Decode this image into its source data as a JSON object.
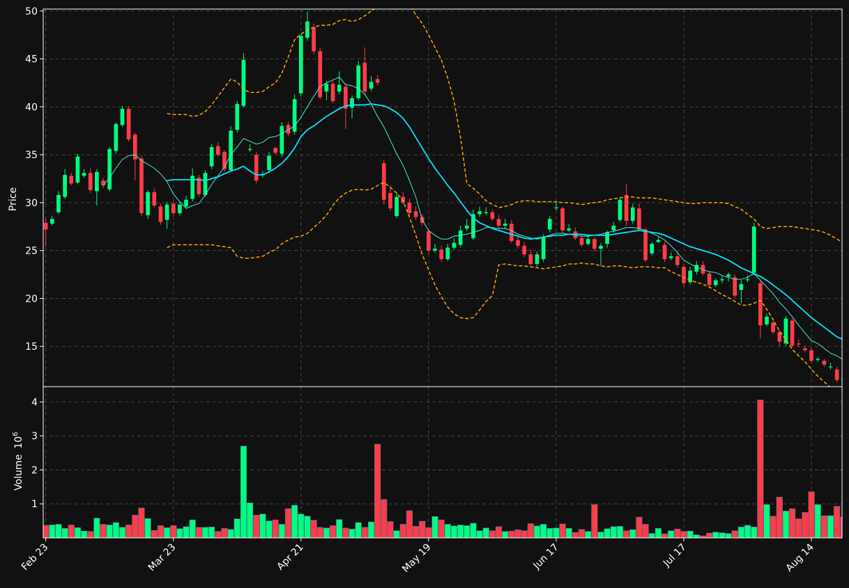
{
  "chart_data": {
    "type": "candlestick",
    "colors": {
      "background": "#111111",
      "up": "#00ff7f",
      "down": "#ff3d47",
      "sma_fast": "#4de8d8",
      "sma_slow": "#00e5ff",
      "bands": "#ffa500",
      "grid": "#444444",
      "frame": "#ffffff"
    },
    "price_axis": {
      "label": "Price",
      "ylim": [
        10.8,
        50.2
      ],
      "ticks": [
        15,
        20,
        25,
        30,
        35,
        40,
        45,
        50
      ]
    },
    "volume_axis": {
      "label": "Volume",
      "exponent_label": "10",
      "exponent": "6",
      "ylim": [
        0,
        4.45
      ],
      "ticks": [
        1,
        2,
        3,
        4
      ]
    },
    "x_axis": {
      "ticks": [
        {
          "index": 0,
          "label": "Feb 23"
        },
        {
          "index": 20,
          "label": "Mar 23"
        },
        {
          "index": 40,
          "label": "Apr 21"
        },
        {
          "index": 60,
          "label": "May 19"
        },
        {
          "index": 80,
          "label": "Jun 17"
        },
        {
          "index": 100,
          "label": "Jul 17"
        },
        {
          "index": 120,
          "label": "Aug 14"
        }
      ]
    },
    "close": [
      27.2,
      28.3,
      30.8,
      32.9,
      32.0,
      34.8,
      33.1,
      31.3,
      33.2,
      31.8,
      35.6,
      38.2,
      39.8,
      36.6,
      34.5,
      28.9,
      31.1,
      29.7,
      28.0,
      29.8,
      28.9,
      29.8,
      30.3,
      32.8,
      30.9,
      33.1,
      35.8,
      35.0,
      33.5,
      37.5,
      40.3,
      44.9,
      35.6,
      32.3,
      33.0,
      34.9,
      35.2,
      38.0,
      37.2,
      40.8,
      47.4,
      48.9,
      45.8,
      41.0,
      42.4,
      40.6,
      42.3,
      39.8,
      40.9,
      44.3,
      41.6,
      42.6,
      42.5,
      30.3,
      29.4,
      30.6,
      30.0,
      28.9,
      28.5,
      27.9,
      25.0,
      25.2,
      24.1,
      25.3,
      25.8,
      27.1,
      27.6,
      28.8,
      29.1,
      29.0,
      28.3,
      27.6,
      27.8,
      26.0,
      25.5,
      24.6,
      23.6,
      24.6,
      26.4,
      28.3,
      29.5,
      27.1,
      27.3,
      26.3,
      25.6,
      26.2,
      25.2,
      25.5,
      26.9,
      27.6,
      30.3,
      28.1,
      29.5,
      27.2,
      24.0,
      25.7,
      26.1,
      24.1,
      24.4,
      23.5,
      21.6,
      22.9,
      23.5,
      22.6,
      21.4,
      21.9,
      22.0,
      22.5,
      20.3,
      21.5,
      22.0,
      27.5,
      17.2,
      18.1,
      16.5,
      15.5,
      17.9,
      15.1,
      15.2,
      14.6,
      13.5,
      13.7,
      13.1,
      12.9,
      11.5,
      11.5
    ],
    "open": [
      27.9,
      27.8,
      29.0,
      30.6,
      32.8,
      32.1,
      32.8,
      33.1,
      31.2,
      32.3,
      31.4,
      35.4,
      38.1,
      39.8,
      37.1,
      34.6,
      28.7,
      31.1,
      29.6,
      28.2,
      29.9,
      28.9,
      29.6,
      30.4,
      32.6,
      30.8,
      33.8,
      35.9,
      35.3,
      33.4,
      37.6,
      40.1,
      35.5,
      35.0,
      32.9,
      33.4,
      35.7,
      35.1,
      38.1,
      37.4,
      41.4,
      47.2,
      48.3,
      45.8,
      41.6,
      42.4,
      41.6,
      42.1,
      39.9,
      40.9,
      44.6,
      41.9,
      42.9,
      34.1,
      31.0,
      28.6,
      30.6,
      30.0,
      29.1,
      28.5,
      27.0,
      25.0,
      25.1,
      24.1,
      25.3,
      25.6,
      27.3,
      26.3,
      28.8,
      29.0,
      29.0,
      28.3,
      27.6,
      27.8,
      26.1,
      25.5,
      24.6,
      23.6,
      24.1,
      27.2,
      29.5,
      29.4,
      27.1,
      27.0,
      26.3,
      25.7,
      26.2,
      25.2,
      25.7,
      27.1,
      28.2,
      30.8,
      28.1,
      29.4,
      27.2,
      24.7,
      25.9,
      25.6,
      24.2,
      24.4,
      23.3,
      21.7,
      22.8,
      23.5,
      22.6,
      21.4,
      21.9,
      22.3,
      22.2,
      20.9,
      22.0,
      22.7,
      21.6,
      17.3,
      17.5,
      16.5,
      15.3,
      17.7,
      15.3,
      14.8,
      14.6,
      13.6,
      13.5,
      12.9,
      12.6,
      11.7
    ],
    "high": [
      28.4,
      28.6,
      31.2,
      33.5,
      33.1,
      35.1,
      33.5,
      33.6,
      33.5,
      32.6,
      35.8,
      38.4,
      40.1,
      40.1,
      37.3,
      34.9,
      31.3,
      31.5,
      29.9,
      30.1,
      30.2,
      30.1,
      30.7,
      33.6,
      32.9,
      33.4,
      36.1,
      36.3,
      35.5,
      38.0,
      40.6,
      45.6,
      36.1,
      35.3,
      33.3,
      35.3,
      35.8,
      38.4,
      38.4,
      41.3,
      47.6,
      49.9,
      48.7,
      46.1,
      42.7,
      42.7,
      43.7,
      42.5,
      41.2,
      44.8,
      46.2,
      43.2,
      43.3,
      34.4,
      31.8,
      31.1,
      31.1,
      30.4,
      29.6,
      28.8,
      27.2,
      25.7,
      25.5,
      25.7,
      26.3,
      27.6,
      28.3,
      29.3,
      29.6,
      29.5,
      29.3,
      28.7,
      28.3,
      28.2,
      26.6,
      25.9,
      25.1,
      24.9,
      26.7,
      28.6,
      30.1,
      29.6,
      27.8,
      27.4,
      26.7,
      26.6,
      26.4,
      25.8,
      27.1,
      28.0,
      30.6,
      32.0,
      29.9,
      29.9,
      27.4,
      25.9,
      26.4,
      25.9,
      24.8,
      24.9,
      23.6,
      23.3,
      23.9,
      23.9,
      22.8,
      22.1,
      22.3,
      22.7,
      22.5,
      21.9,
      22.4,
      27.9,
      21.9,
      18.4,
      17.9,
      16.7,
      18.2,
      17.9,
      15.7,
      15.1,
      14.9,
      13.9,
      13.7,
      13.3,
      12.9,
      11.8
    ],
    "low": [
      25.4,
      27.6,
      28.8,
      30.4,
      31.8,
      31.9,
      32.6,
      31.0,
      29.7,
      31.5,
      31.2,
      35.1,
      37.9,
      36.4,
      32.3,
      28.6,
      28.3,
      29.5,
      27.7,
      27.3,
      28.6,
      28.7,
      29.4,
      30.1,
      30.6,
      30.6,
      33.5,
      34.8,
      33.2,
      33.2,
      37.3,
      39.9,
      35.3,
      32.0,
      32.6,
      33.2,
      35.0,
      34.8,
      36.9,
      37.1,
      41.1,
      46.9,
      45.5,
      40.8,
      40.7,
      40.4,
      41.3,
      37.7,
      38.8,
      40.7,
      41.3,
      41.6,
      42.2,
      29.8,
      29.1,
      28.4,
      29.8,
      28.6,
      28.2,
      27.6,
      24.6,
      24.8,
      23.8,
      23.9,
      25.1,
      25.3,
      27.0,
      26.1,
      28.5,
      28.7,
      28.1,
      27.3,
      27.3,
      25.8,
      25.2,
      24.3,
      23.4,
      23.3,
      23.8,
      26.9,
      29.2,
      26.8,
      26.9,
      26.1,
      25.4,
      25.5,
      24.9,
      23.4,
      25.3,
      26.9,
      28.0,
      27.6,
      27.8,
      27.0,
      23.8,
      24.5,
      25.8,
      23.8,
      24.0,
      23.2,
      21.3,
      21.5,
      22.5,
      22.4,
      21.2,
      21.2,
      21.6,
      21.8,
      20.1,
      19.5,
      21.7,
      22.4,
      15.8,
      17.1,
      16.3,
      15.0,
      15.1,
      14.9,
      14.9,
      14.4,
      13.3,
      13.4,
      12.9,
      12.6,
      11.2,
      11.1
    ],
    "volume": [
      0.37,
      0.38,
      0.4,
      0.28,
      0.38,
      0.3,
      0.2,
      0.19,
      0.58,
      0.4,
      0.38,
      0.45,
      0.31,
      0.38,
      0.67,
      0.88,
      0.57,
      0.22,
      0.36,
      0.3,
      0.36,
      0.27,
      0.33,
      0.53,
      0.31,
      0.31,
      0.32,
      0.19,
      0.28,
      0.25,
      0.56,
      2.7,
      1.03,
      0.67,
      0.7,
      0.5,
      0.53,
      0.4,
      0.86,
      0.96,
      0.7,
      0.64,
      0.52,
      0.31,
      0.29,
      0.36,
      0.54,
      0.29,
      0.26,
      0.45,
      0.31,
      0.47,
      2.76,
      1.13,
      0.48,
      0.21,
      0.4,
      0.8,
      0.34,
      0.49,
      0.3,
      0.63,
      0.53,
      0.4,
      0.35,
      0.38,
      0.36,
      0.43,
      0.21,
      0.29,
      0.21,
      0.33,
      0.19,
      0.2,
      0.24,
      0.21,
      0.42,
      0.35,
      0.4,
      0.28,
      0.29,
      0.41,
      0.28,
      0.16,
      0.25,
      0.19,
      0.98,
      0.17,
      0.27,
      0.33,
      0.34,
      0.21,
      0.24,
      0.61,
      0.4,
      0.13,
      0.28,
      0.12,
      0.21,
      0.26,
      0.19,
      0.2,
      0.09,
      0.06,
      0.14,
      0.17,
      0.15,
      0.13,
      0.21,
      0.32,
      0.37,
      0.32,
      4.06,
      0.98,
      0.64,
      1.2,
      0.79,
      0.86,
      0.56,
      0.75,
      1.36,
      0.98,
      0.65,
      0.65,
      0.93,
      0.61
    ],
    "sma_fast": [
      null,
      null,
      null,
      null,
      null,
      null,
      null,
      null,
      null,
      31.8,
      32.6,
      33.6,
      34.5,
      34.9,
      35.0,
      34.4,
      34.0,
      33.6,
      33.0,
      32.2,
      30.9,
      30.1,
      29.4,
      29.7,
      29.9,
      30.8,
      31.9,
      32.8,
      33.7,
      35.0,
      35.8,
      36.7,
      36.4,
      36.1,
      36.3,
      36.8,
      36.9,
      37.2,
      37.6,
      38.0,
      38.9,
      40.0,
      41.1,
      42.1,
      42.5,
      42.8,
      43.1,
      42.3,
      42.2,
      41.9,
      41.3,
      40.3,
      39.0,
      37.9,
      36.5,
      35.1,
      33.9,
      32.3,
      30.6,
      28.2,
      27.1,
      26.6,
      26.2,
      26.2,
      26.5,
      26.6,
      26.7,
      26.9,
      27.1,
      27.4,
      27.4,
      27.3,
      27.3,
      27.1,
      26.7,
      26.5,
      26.3,
      26.2,
      26.4,
      26.6,
      26.8,
      26.8,
      26.7,
      26.6,
      26.5,
      26.5,
      26.6,
      26.7,
      26.9,
      27.0,
      27.2,
      27.4,
      27.4,
      27.3,
      27.1,
      26.8,
      26.5,
      26.1,
      25.5,
      24.8,
      24.0,
      23.6,
      23.3,
      23.0,
      22.8,
      22.7,
      22.4,
      22.2,
      22.0,
      22.0,
      22.2,
      22.6,
      21.9,
      21.2,
      20.5,
      19.6,
      18.9,
      18.1,
      17.2,
      16.4,
      15.6,
      15.3,
      14.8,
      14.3,
      14.0,
      13.6
    ],
    "sma_slow": [
      null,
      null,
      null,
      null,
      null,
      null,
      null,
      null,
      null,
      null,
      null,
      null,
      null,
      null,
      null,
      null,
      null,
      null,
      null,
      32.3,
      32.4,
      32.4,
      32.4,
      32.4,
      32.4,
      32.3,
      32.5,
      32.7,
      33.0,
      33.3,
      33.5,
      33.8,
      33.3,
      32.9,
      32.9,
      33.2,
      33.6,
      34.1,
      34.8,
      35.7,
      36.9,
      37.6,
      38.0,
      38.5,
      39.0,
      39.4,
      39.8,
      40.1,
      40.2,
      40.2,
      40.2,
      40.3,
      40.2,
      40.1,
      39.8,
      39.4,
      38.8,
      37.9,
      36.8,
      35.7,
      34.6,
      33.6,
      32.7,
      31.8,
      31.0,
      30.1,
      29.2,
      28.4,
      27.9,
      27.6,
      27.3,
      27.1,
      26.9,
      26.7,
      26.5,
      26.3,
      26.2,
      26.3,
      26.4,
      26.5,
      26.6,
      26.6,
      26.7,
      26.7,
      26.7,
      26.6,
      26.6,
      26.6,
      26.6,
      26.7,
      26.8,
      26.9,
      27.0,
      27.1,
      27.0,
      26.9,
      26.8,
      26.6,
      26.3,
      26.0,
      25.7,
      25.4,
      25.2,
      25.0,
      24.8,
      24.6,
      24.3,
      24.0,
      23.6,
      23.2,
      22.9,
      22.6,
      22.3,
      21.9,
      21.4,
      20.9,
      20.4,
      19.8,
      19.2,
      18.6,
      18.0,
      17.5,
      17.0,
      16.5,
      16.0,
      15.7
    ],
    "band_upper": [
      null,
      null,
      null,
      null,
      null,
      null,
      null,
      null,
      null,
      null,
      null,
      null,
      null,
      null,
      null,
      null,
      null,
      null,
      null,
      39.3,
      39.2,
      39.2,
      39.2,
      39.0,
      39.1,
      39.5,
      40.2,
      41.1,
      42.0,
      42.9,
      42.6,
      41.8,
      41.5,
      41.5,
      41.6,
      42.1,
      42.5,
      43.5,
      45.2,
      47.0,
      47.6,
      48.0,
      48.3,
      48.5,
      48.5,
      48.6,
      49.0,
      49.1,
      48.9,
      49.1,
      49.5,
      50.0,
      50.4,
      50.8,
      51.2,
      51.4,
      51.2,
      50.6,
      49.6,
      48.7,
      47.5,
      46.2,
      44.9,
      43.0,
      40.6,
      36.8,
      32.0,
      31.5,
      30.9,
      30.2,
      29.8,
      29.5,
      29.6,
      29.8,
      30.1,
      30.2,
      30.2,
      30.1,
      30.1,
      30.1,
      30.1,
      30.0,
      30.0,
      29.9,
      29.8,
      29.9,
      30.0,
      30.1,
      30.3,
      30.4,
      30.5,
      30.6,
      30.6,
      30.5,
      30.5,
      30.5,
      30.4,
      30.3,
      30.2,
      30.1,
      30.0,
      29.9,
      29.9,
      30.0,
      30.0,
      30.0,
      30.0,
      29.9,
      29.6,
      29.3,
      28.8,
      28.3,
      27.5,
      27.3,
      27.4,
      27.5,
      27.5,
      27.5,
      27.4,
      27.3,
      27.2,
      27.1,
      26.9,
      26.6,
      26.2,
      25.8
    ],
    "band_lower": [
      null,
      null,
      null,
      null,
      null,
      null,
      null,
      null,
      null,
      null,
      null,
      null,
      null,
      null,
      null,
      null,
      null,
      null,
      null,
      25.3,
      25.6,
      25.6,
      25.6,
      25.6,
      25.6,
      25.6,
      25.6,
      25.5,
      25.4,
      25.3,
      24.4,
      24.2,
      24.2,
      24.3,
      24.4,
      24.8,
      25.1,
      25.7,
      26.1,
      26.4,
      26.5,
      26.8,
      27.4,
      28.0,
      28.7,
      29.7,
      30.5,
      31.0,
      31.3,
      31.4,
      31.3,
      31.4,
      31.8,
      32.1,
      31.6,
      31.0,
      30.2,
      28.5,
      26.6,
      24.6,
      23.0,
      21.4,
      20.2,
      19.1,
      18.4,
      18.0,
      17.9,
      18.0,
      18.8,
      19.7,
      20.3,
      23.5,
      23.6,
      23.5,
      23.4,
      23.4,
      23.3,
      23.2,
      23.1,
      23.2,
      23.3,
      23.4,
      23.6,
      23.6,
      23.7,
      23.6,
      23.6,
      23.4,
      23.3,
      23.4,
      23.4,
      23.3,
      23.2,
      23.3,
      23.3,
      23.3,
      23.2,
      23.2,
      22.8,
      22.5,
      22.2,
      21.9,
      21.7,
      21.5,
      21.2,
      20.8,
      20.4,
      20.1,
      19.7,
      19.3,
      19.3,
      19.5,
      19.8,
      18.9,
      17.8,
      16.6,
      15.7,
      14.7,
      14.0,
      13.4,
      12.6,
      11.9,
      11.3,
      10.7,
      10.2,
      9.6
    ]
  }
}
